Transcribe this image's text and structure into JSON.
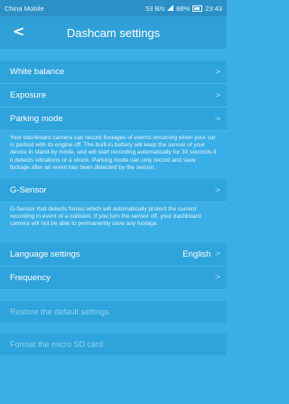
{
  "status_bar": {
    "carrier": "China Mobile",
    "speed": "53 B/s",
    "battery": "88%",
    "time": "23:43"
  },
  "header": {
    "title": "Dashcam settings",
    "back_icon": "chevron-left-icon"
  },
  "settings": {
    "white_balance": "White balance",
    "exposure": "Exposure",
    "parking_mode": "Parking mode",
    "parking_desc": "Your dashboard camera can record footages of events occurring when your car is parked with its engine off. The built-in battery will keep the sensor of your device in stand-by mode, and will start recording automatically for 30 seconds if it detects vibrations or a shock. Parking mode can only record and save footage after an event has been detected by the sensor.",
    "g_sensor": "G-Sensor",
    "g_sensor_desc": "G-Sensor that detects forces which will automatically protect the current recording in event of a collision. If you turn the sensor off, your dashboard camera will not be able to permanently save any footage.",
    "language": "Language settings",
    "language_value": "English",
    "frequency": "Frequency",
    "restore": "Restore the default settings",
    "format": "Format the micro SD card"
  },
  "colors": {
    "background": "#3aaee6",
    "header": "#2f9fd8",
    "row": "#2ea3dc"
  }
}
